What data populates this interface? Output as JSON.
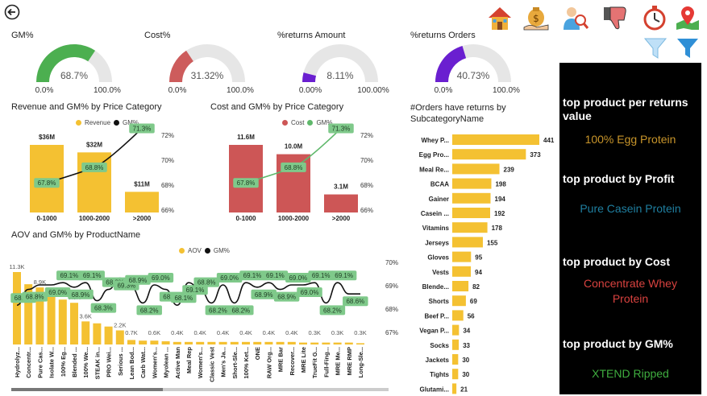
{
  "back_icon": "back-arrow-icon",
  "toolbar_icons": [
    "home-icon",
    "money-bag-icon",
    "user-search-icon",
    "thumbs-down-icon",
    "stopwatch-icon",
    "map-pin-icon",
    "filter-clear-icon",
    "filter-icon"
  ],
  "gauges": [
    {
      "title": "GM%",
      "value": "68.7%",
      "min": "0.0%",
      "max": "100.0%",
      "fraction": 0.687,
      "color": "#4caf50"
    },
    {
      "title": "Cost%",
      "value": "31.32%",
      "min": "0.0%",
      "max": "100.0%",
      "fraction": 0.3132,
      "color": "#cd5c5c"
    },
    {
      "title": "%returns Amount",
      "value": "8.11%",
      "min": "0.00%",
      "max": "100.00%",
      "fraction": 0.0811,
      "color": "#6a1fd0"
    },
    {
      "title": "%returns Orders",
      "value": "40.73%",
      "min": "0.0%",
      "max": "100.0%",
      "fraction": 0.4073,
      "color": "#6a1fd0"
    }
  ],
  "kpis": [
    {
      "title": "top product per returns value",
      "value": "100% Egg Protein",
      "color": "#c8952a"
    },
    {
      "title": "top product by Profit",
      "value": "Pure Casein Protein",
      "color": "#1f7fa0"
    },
    {
      "title": "top product by Cost",
      "value": "Concentrate Whey Protein",
      "color": "#d9423f"
    },
    {
      "title": "top product by GM%",
      "value": "XTEND Ripped",
      "color": "#3fae3f"
    }
  ],
  "chart_data": [
    {
      "type": "bar",
      "title": "Revenue and GM% by Price Category",
      "legend": [
        "Revenue",
        "GM%"
      ],
      "categories": [
        "0-1000",
        "1000-2000",
        ">2000"
      ],
      "series": [
        {
          "name": "Revenue",
          "values": [
            36,
            32,
            11
          ],
          "labels": [
            "$36M",
            "$32M",
            "$11M"
          ],
          "color": "#f4c132"
        },
        {
          "name": "GM%",
          "values": [
            67.8,
            68.8,
            71.3
          ],
          "labels": [
            "67.8%",
            "68.8%",
            "71.3%"
          ],
          "color": "#111111"
        }
      ],
      "y2_ticks": [
        "72%",
        "70%",
        "68%",
        "66%"
      ],
      "y2lim": [
        66,
        72
      ]
    },
    {
      "type": "bar",
      "title": "Cost and GM% by Price Category",
      "legend": [
        "Cost",
        "GM%"
      ],
      "categories": [
        "0-1000",
        "1000-2000",
        ">2000"
      ],
      "series": [
        {
          "name": "Cost",
          "values": [
            11.6,
            10.0,
            3.1
          ],
          "labels": [
            "11.6M",
            "10.0M",
            "3.1M"
          ],
          "color": "#cd5656"
        },
        {
          "name": "GM%",
          "values": [
            67.8,
            68.8,
            71.3
          ],
          "labels": [
            "67.8%",
            "68.8%",
            "71.3%"
          ],
          "color": "#5fb86b"
        }
      ],
      "y2_ticks": [
        "72%",
        "70%",
        "68%",
        "66%"
      ],
      "y2lim": [
        66,
        72
      ]
    },
    {
      "type": "bar",
      "title": "#Orders have returns by SubcategoryName",
      "orientation": "horizontal",
      "categories": [
        "Whey P...",
        "Egg Pro...",
        "Meal Re...",
        "BCAA",
        "Gainer",
        "Casein ...",
        "Vitamins",
        "Jerseys",
        "Gloves",
        "Vests",
        "Blende...",
        "Shorts",
        "Beef P...",
        "Vegan P...",
        "Socks",
        "Jackets",
        "Tights",
        "Glutami..."
      ],
      "values": [
        441,
        373,
        239,
        198,
        194,
        192,
        178,
        155,
        95,
        94,
        82,
        69,
        56,
        34,
        33,
        30,
        30,
        21
      ],
      "color": "#f4c132"
    },
    {
      "type": "bar",
      "title": "AOV and GM% by ProductName",
      "legend": [
        "AOV",
        "GM%"
      ],
      "categories": [
        "Hydrolyz...",
        "Concentr...",
        "Pure Cas...",
        "Isolate W...",
        "100% Eg...",
        "Blended ...",
        "100% We...",
        "STEAK in...",
        "PRO Wei...",
        "Serious ...",
        "Lean Bod...",
        "Carb Wat...",
        "Women's...",
        "Myolean ...",
        "Active Man",
        "Meal Rep",
        "Women's...",
        "Classic Vest",
        "Men's Ja...",
        "Short-Sle...",
        "100% Ket...",
        "ONE",
        "RAW Org...",
        "MRE Bar",
        "Recover...",
        "MRE Lite",
        "TrueFit G...",
        "Full-Fing...",
        "MRE Me...",
        "MRE RMP",
        "Long-Sle..."
      ],
      "aov_values": [
        11.3,
        9.4,
        8.9,
        7.9,
        7.0,
        6.5,
        3.6,
        3.3,
        2.8,
        2.2,
        0.7,
        0.6,
        0.6,
        0.5,
        0.4,
        0.4,
        0.4,
        0.4,
        0.4,
        0.4,
        0.4,
        0.4,
        0.4,
        0.4,
        0.4,
        0.3,
        0.3,
        0.3,
        0.3,
        0.3,
        0.2
      ],
      "aov_labels": [
        {
          "i": 0,
          "text": "11.3K"
        },
        {
          "i": 2,
          "text": "8.9K"
        },
        {
          "i": 4,
          "text": "7.0K"
        },
        {
          "i": 5,
          "text": "6.5K"
        },
        {
          "i": 6,
          "text": "3.6K"
        },
        {
          "i": 9,
          "text": "2.2K"
        },
        {
          "i": 10,
          "text": "0.7K"
        },
        {
          "i": 12,
          "text": "0.6K"
        },
        {
          "i": 14,
          "text": "0.4K"
        },
        {
          "i": 16,
          "text": "0.4K"
        },
        {
          "i": 18,
          "text": "0.4K"
        },
        {
          "i": 20,
          "text": "0.4K"
        },
        {
          "i": 22,
          "text": "0.4K"
        },
        {
          "i": 24,
          "text": "0.4K"
        },
        {
          "i": 26,
          "text": "0.3K"
        },
        {
          "i": 28,
          "text": "0.3K"
        },
        {
          "i": 30,
          "text": "0.3K"
        }
      ],
      "gm_values": [
        68.1,
        68.8,
        69.0,
        69.0,
        69.1,
        68.9,
        69.1,
        68.3,
        68.8,
        69.3,
        68.9,
        68.2,
        69.0,
        68.8,
        68.1,
        69.1,
        68.8,
        68.2,
        69.0,
        68.2,
        69.1,
        68.9,
        69.1,
        68.8,
        69.0,
        69.0,
        69.1,
        68.2,
        69.1,
        68.6,
        68.6
      ],
      "gm_labels": [
        {
          "i": 0,
          "text": "68.1%"
        },
        {
          "i": 1,
          "text": "68.8%"
        },
        {
          "i": 3,
          "text": "69.0%"
        },
        {
          "i": 4,
          "text": "69.1%"
        },
        {
          "i": 5,
          "text": "68.9%"
        },
        {
          "i": 6,
          "text": "69.1%"
        },
        {
          "i": 7,
          "text": "68.3%"
        },
        {
          "i": 8,
          "text": "68.8%"
        },
        {
          "i": 9,
          "text": "69.3%"
        },
        {
          "i": 10,
          "text": "68.9%"
        },
        {
          "i": 11,
          "text": "68.2%"
        },
        {
          "i": 12,
          "text": "69.0%"
        },
        {
          "i": 13,
          "text": "68.8%"
        },
        {
          "i": 14,
          "text": "68.1%"
        },
        {
          "i": 15,
          "text": "69.1%"
        },
        {
          "i": 16,
          "text": "68.8%"
        },
        {
          "i": 17,
          "text": "68.2%"
        },
        {
          "i": 18,
          "text": "69.0%"
        },
        {
          "i": 19,
          "text": "68.2%"
        },
        {
          "i": 20,
          "text": "69.1%"
        },
        {
          "i": 21,
          "text": "68.9%"
        },
        {
          "i": 22,
          "text": "69.1%"
        },
        {
          "i": 23,
          "text": "68.9%"
        },
        {
          "i": 24,
          "text": "69.0%"
        },
        {
          "i": 25,
          "text": "69.0%"
        },
        {
          "i": 26,
          "text": "69.1%"
        },
        {
          "i": 27,
          "text": "68.2%"
        },
        {
          "i": 28,
          "text": "69.1%"
        },
        {
          "i": 29,
          "text": "68.6%"
        }
      ],
      "y2_ticks": [
        "70%",
        "69%",
        "68%",
        "67%"
      ],
      "y2lim": [
        67,
        70
      ]
    }
  ]
}
